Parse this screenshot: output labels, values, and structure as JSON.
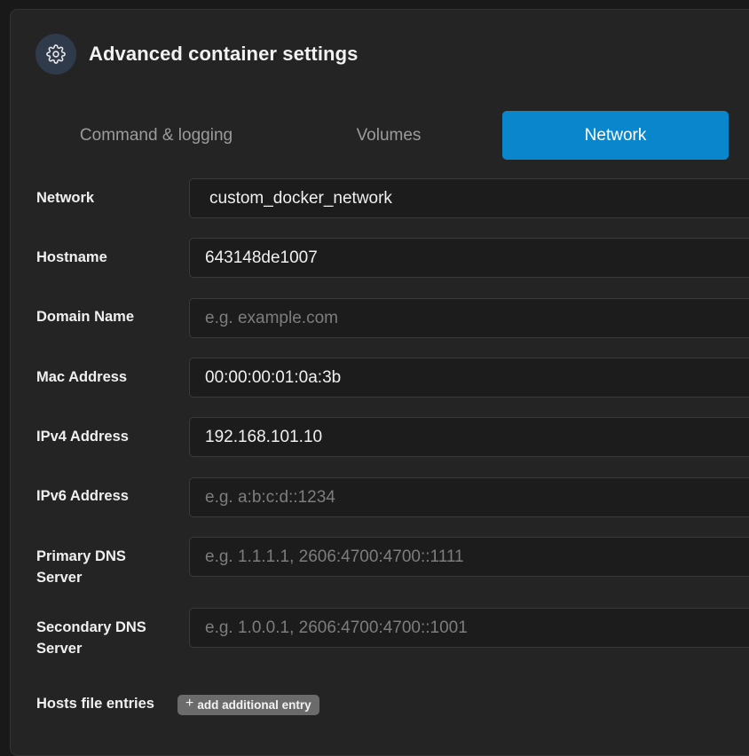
{
  "header": {
    "title": "Advanced container settings",
    "icon": "gear-icon"
  },
  "tabs": [
    {
      "label": "Command & logging",
      "active": false
    },
    {
      "label": "Volumes",
      "active": false
    },
    {
      "label": "Network",
      "active": true
    }
  ],
  "colors": {
    "accent": "#0a86cd",
    "background": "#242424",
    "field_background": "#1c1c1c"
  },
  "form": {
    "network": {
      "label": "Network",
      "value": "custom_docker_network"
    },
    "hostname": {
      "label": "Hostname",
      "value": "643148de1007"
    },
    "domain_name": {
      "label": "Domain Name",
      "value": "",
      "placeholder": "e.g. example.com"
    },
    "mac_address": {
      "label": "Mac Address",
      "value": "00:00:00:01:0a:3b"
    },
    "ipv4_address": {
      "label": "IPv4 Address",
      "value": "192.168.101.10"
    },
    "ipv6_address": {
      "label": "IPv6 Address",
      "value": "",
      "placeholder": "e.g. a:b:c:d::1234"
    },
    "primary_dns": {
      "label_line1": "Primary DNS",
      "label_line2": "Server",
      "value": "",
      "placeholder": "e.g. 1.1.1.1, 2606:4700:4700::1111"
    },
    "secondary_dns": {
      "label_line1": "Secondary DNS",
      "label_line2": "Server",
      "value": "",
      "placeholder": "e.g. 1.0.0.1, 2606:4700:4700::1001"
    },
    "hosts_file": {
      "label": "Hosts file entries",
      "add_button": "add additional entry",
      "add_icon": "plus-icon"
    }
  }
}
